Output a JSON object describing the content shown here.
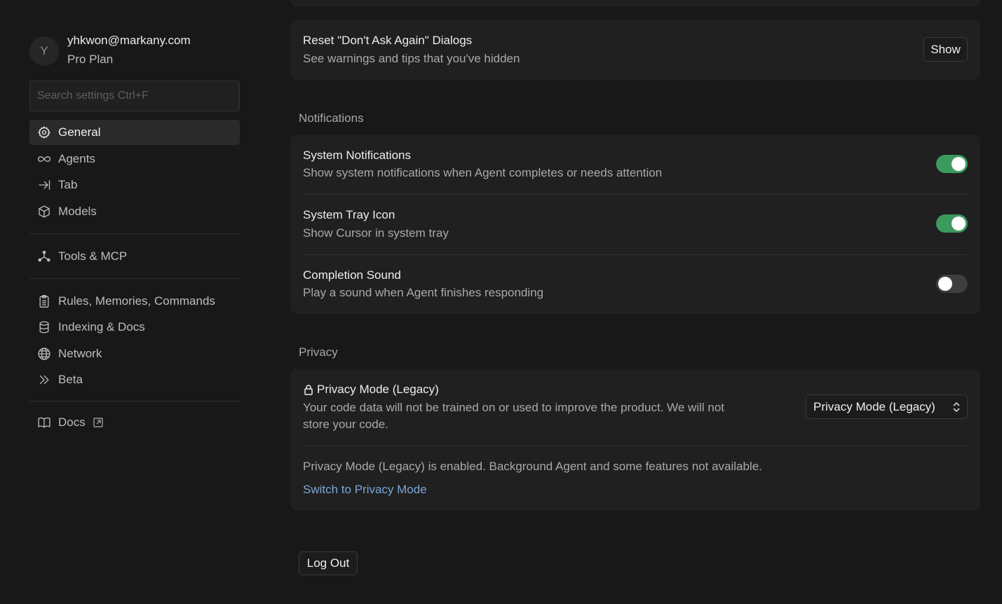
{
  "profile": {
    "avatar_initial": "Y",
    "email": "yhkwon@markany.com",
    "plan": "Pro Plan"
  },
  "search": {
    "placeholder": "Search settings Ctrl+F"
  },
  "sidebar": {
    "items": [
      {
        "label": "General",
        "icon": "gear-icon",
        "active": true
      },
      {
        "label": "Agents",
        "icon": "infinity-icon"
      },
      {
        "label": "Tab",
        "icon": "arrow-right-to-bar-icon"
      },
      {
        "label": "Models",
        "icon": "cube-icon"
      },
      {
        "label": "Tools & MCP",
        "icon": "nodes-icon"
      },
      {
        "label": "Rules, Memories, Commands",
        "icon": "clipboard-icon"
      },
      {
        "label": "Indexing & Docs",
        "icon": "database-icon"
      },
      {
        "label": "Network",
        "icon": "globe-icon"
      },
      {
        "label": "Beta",
        "icon": "double-chevron-right-icon"
      },
      {
        "label": "Docs",
        "icon": "book-icon"
      }
    ]
  },
  "reset_dialogs": {
    "title": "Reset \"Don't Ask Again\" Dialogs",
    "description": "See warnings and tips that you've hidden",
    "button": "Show"
  },
  "notifications": {
    "section": "Notifications",
    "items": [
      {
        "title": "System Notifications",
        "description": "Show system notifications when Agent completes or needs attention",
        "enabled": true
      },
      {
        "title": "System Tray Icon",
        "description": "Show Cursor in system tray",
        "enabled": true
      },
      {
        "title": "Completion Sound",
        "description": "Play a sound when Agent finishes responding",
        "enabled": false
      }
    ]
  },
  "privacy": {
    "section": "Privacy",
    "title": "Privacy Mode (Legacy)",
    "description_line1": "Your code data will not be trained on or used to improve the product. We will not",
    "description_line2": "store your code.",
    "select_value": "Privacy Mode (Legacy)",
    "status": "Privacy Mode (Legacy) is enabled. Background Agent and some features not available.",
    "link": "Switch to Privacy Mode"
  },
  "logout": "Log Out",
  "colors": {
    "accent_toggle": "#3c9a5f",
    "link": "#7aa6d6",
    "background": "#181818",
    "card": "#202020"
  }
}
